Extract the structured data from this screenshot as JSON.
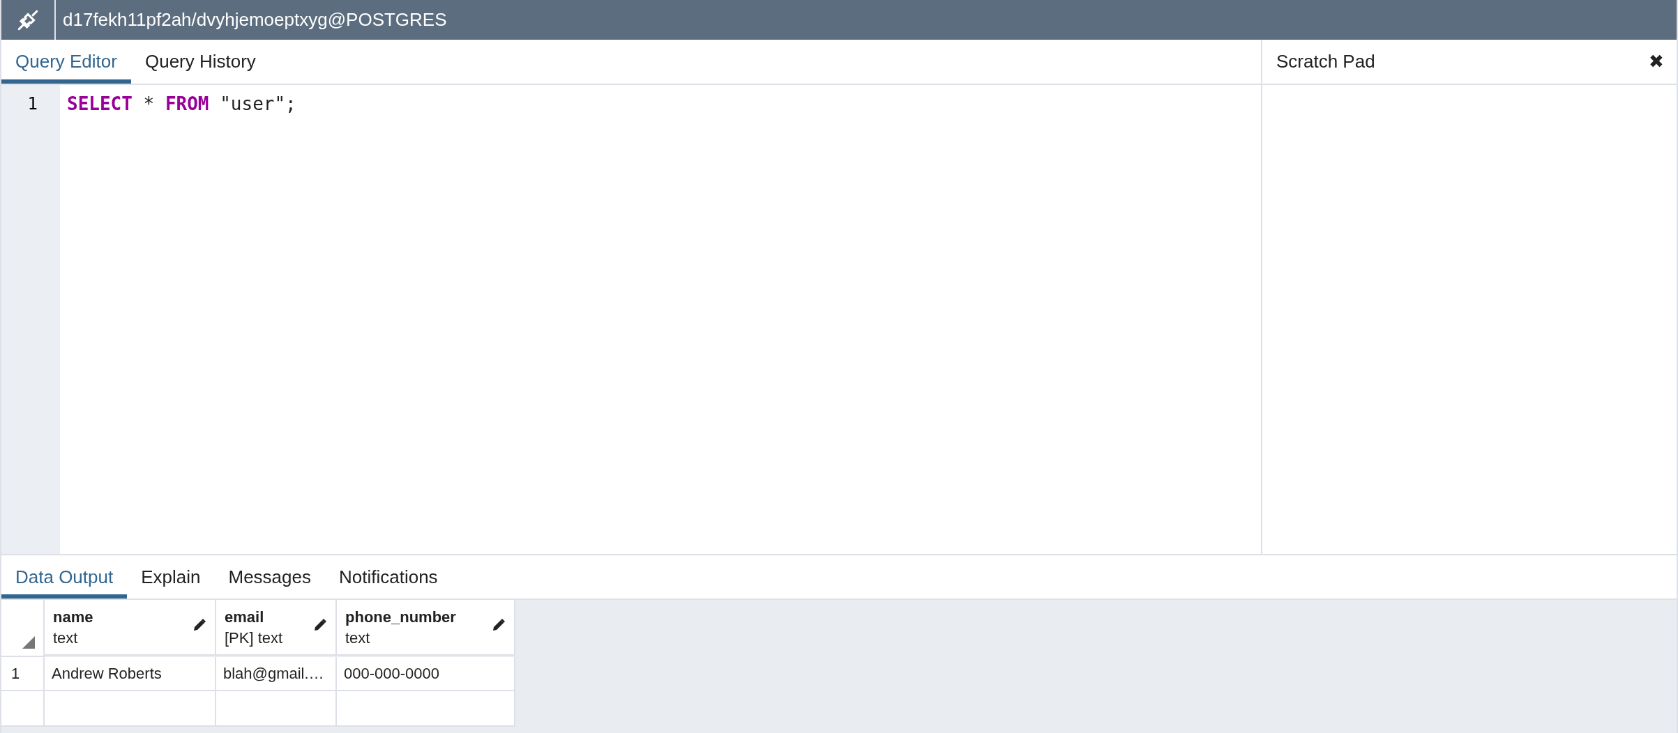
{
  "title_bar": {
    "title": "d17fekh11pf2ah/dvyhjemoeptxyg@POSTGRES"
  },
  "editor_tabs": [
    {
      "label": "Query Editor",
      "selected": true
    },
    {
      "label": "Query History",
      "selected": false
    }
  ],
  "scratch_pad": {
    "title": "Scratch Pad",
    "close": "✖"
  },
  "editor": {
    "lines": [
      {
        "number": "1",
        "tokens": [
          {
            "kind": "keyword",
            "text": "SELECT"
          },
          {
            "kind": "plain",
            "text": " * "
          },
          {
            "kind": "keyword",
            "text": "FROM"
          },
          {
            "kind": "plain",
            "text": " \"user\";"
          }
        ]
      }
    ]
  },
  "output_tabs": [
    {
      "label": "Data Output",
      "selected": true
    },
    {
      "label": "Explain",
      "selected": false
    },
    {
      "label": "Messages",
      "selected": false
    },
    {
      "label": "Notifications",
      "selected": false
    }
  ],
  "table": {
    "columns": [
      {
        "name": "name",
        "type": "text"
      },
      {
        "name": "email",
        "type": "[PK] text"
      },
      {
        "name": "phone_number",
        "type": "text"
      }
    ],
    "rows": [
      {
        "number": "1",
        "cells": [
          "Andrew Roberts",
          "blah@gmail.…",
          "000-000-0000"
        ]
      }
    ]
  }
}
